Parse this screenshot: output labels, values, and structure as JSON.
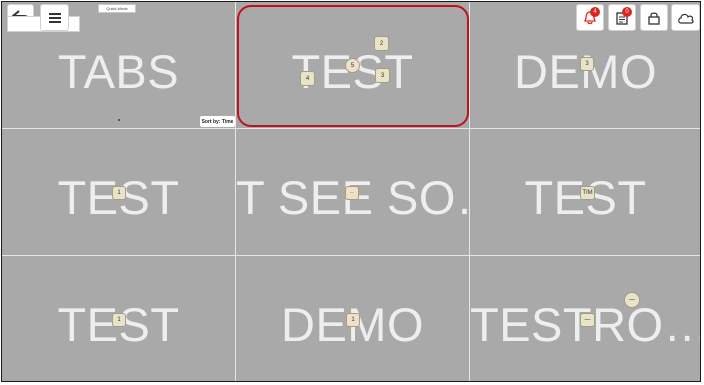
{
  "top_left": {
    "back_icon": "back-arrow-icon",
    "menu_icon": "hamburger-icon",
    "mode_tag": "Quick Mode"
  },
  "top_right": {
    "notifications_badge": "4",
    "tasks_badge": "0",
    "lock_icon": "lock-icon",
    "cloud_icon": "cloud-icon"
  },
  "sort_label": "Sort by: Time",
  "cells": [
    {
      "label": "TABS"
    },
    {
      "label": "TEST"
    },
    {
      "label": "DEMO"
    },
    {
      "label": "TEST"
    },
    {
      "label": "T SEE SO…"
    },
    {
      "label": "TEST"
    },
    {
      "label": "TEST"
    },
    {
      "label": "DEMO"
    },
    {
      "label": "TESTRO…"
    }
  ],
  "markers": {
    "c2_a": "2",
    "c2_b": "5",
    "c2_c": "4",
    "c2_d": "3",
    "c3": "3",
    "c4": "1",
    "c5": "··",
    "c6": "TIM",
    "c7": "1",
    "c8": "1",
    "c9_a": "—",
    "c9_b": "—"
  },
  "colors": {
    "grid_bg": "#a9a9a9",
    "selected_border": "#c0121a",
    "badge": "#e0241c"
  }
}
